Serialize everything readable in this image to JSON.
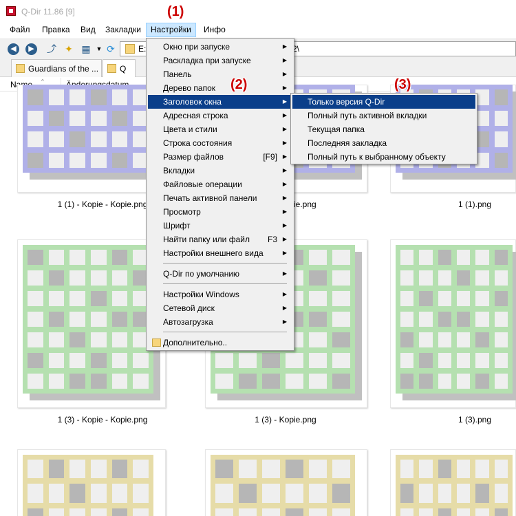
{
  "window": {
    "title": "Q-Dir 11.86 [9]"
  },
  "menubar": {
    "items": [
      "Файл",
      "Правка",
      "Вид",
      "Закладки",
      "Настройки",
      "Инфо"
    ]
  },
  "address": {
    "left_text": "E:\\",
    "right_text": "2\\"
  },
  "tabs": [
    {
      "label": "Guardians of the ..."
    },
    {
      "label": "Q"
    }
  ],
  "columns": {
    "name": "Name",
    "date": "Änderungsdatum"
  },
  "thumbnails": [
    {
      "label": "1 (1) - Kopie - Kopie.png",
      "color": "#b0b0e8"
    },
    {
      "label": "1 (1) - Kopie.png",
      "color": "#b0b0e8"
    },
    {
      "label": "1 (1).png",
      "color": "#b0b0e8"
    },
    {
      "label": "1 (3) - Kopie - Kopie.png",
      "color": "#b5e0b0"
    },
    {
      "label": "1 (3) - Kopie.png",
      "color": "#b5e0b0"
    },
    {
      "label": "1 (3).png",
      "color": "#b5e0b0"
    },
    {
      "label": "",
      "color": "#e6dca8"
    },
    {
      "label": "",
      "color": "#e6dca8"
    },
    {
      "label": "",
      "color": "#e6dca8"
    }
  ],
  "settings_menu": {
    "items": [
      {
        "label": "Окно при запуске",
        "submenu": true
      },
      {
        "label": "Раскладка при запуске",
        "submenu": true
      },
      {
        "label": "Панель",
        "submenu": true
      },
      {
        "label": "Дерево папок",
        "submenu": true
      },
      {
        "label": "Заголовок окна",
        "submenu": true
      },
      {
        "label": "Адресная строка",
        "submenu": true
      },
      {
        "label": "Цвета и стили",
        "submenu": true
      },
      {
        "label": "Строка состояния",
        "submenu": true
      },
      {
        "label": "Размер файлов",
        "shortcut": "[F9]",
        "submenu": true
      },
      {
        "label": "Вкладки",
        "submenu": true
      },
      {
        "label": "Файловые операции",
        "submenu": true
      },
      {
        "label": "Печать активной панели",
        "submenu": true
      },
      {
        "label": "Просмотр",
        "submenu": true
      },
      {
        "label": "Шрифт",
        "submenu": true
      },
      {
        "label": "Найти папку или файл",
        "shortcut": "F3",
        "submenu": true
      },
      {
        "label": "Настройки внешнего вида",
        "submenu": true
      },
      {
        "label": "Q-Dir по умолчанию",
        "submenu": true
      },
      {
        "label": "Настройки Windows",
        "submenu": true
      },
      {
        "label": "Сетевой диск",
        "submenu": true
      },
      {
        "label": "Автозагрузка",
        "submenu": true
      },
      {
        "label": "Дополнительно..",
        "submenu": false
      }
    ]
  },
  "title_submenu": {
    "items": [
      "Только версия Q-Dir",
      "Полный путь активной вкладки",
      "Текущая папка",
      "Последняя закладка",
      "Полный путь к выбранному объекту"
    ]
  },
  "callouts": [
    "(1)",
    "(2)",
    "(3)"
  ]
}
